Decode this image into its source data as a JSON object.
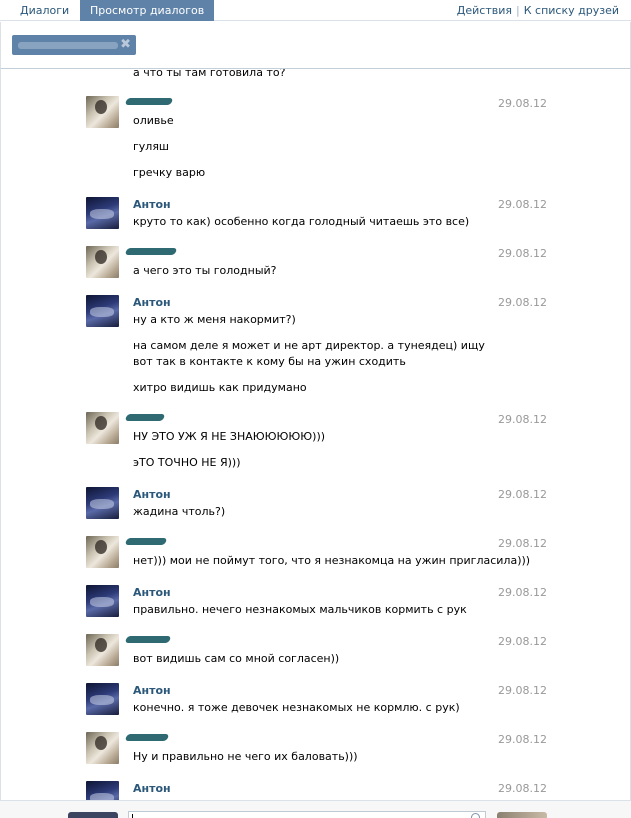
{
  "nav": {
    "tab_dialogs": "Диалоги",
    "tab_view": "Просмотр диалогов",
    "link_actions": "Действия",
    "separator": "|",
    "link_friends": "К списку друзей"
  },
  "token": {
    "close_glyph": "✖"
  },
  "messages": [
    {
      "author": "",
      "date": "",
      "lines": [
        "а что ты там готовила то?"
      ]
    },
    {
      "author": "",
      "date": "29.08.12",
      "lines": [
        "оливье",
        "гуляш",
        "гречку варю"
      ]
    },
    {
      "author": "Антон",
      "date": "29.08.12",
      "lines": [
        "круто то как) особенно когда голодный читаешь это все)"
      ]
    },
    {
      "author": "",
      "date": "29.08.12",
      "lines": [
        "а чего это ты голодный?"
      ]
    },
    {
      "author": "Антон",
      "date": "29.08.12",
      "lines": [
        "ну а кто ж меня накормит?)",
        "на самом деле я может и не арт директор. а тунеядец) ищу вот так в контакте к кому бы на ужин сходить",
        "хитро видишь как придумано"
      ]
    },
    {
      "author": "",
      "date": "29.08.12",
      "lines": [
        "НУ ЭТО УЖ Я НЕ ЗНАЮЮЮЮЮ)))",
        "эТО ТОЧНО НЕ Я)))"
      ]
    },
    {
      "author": "Антон",
      "date": "29.08.12",
      "lines": [
        "жадина чтоль?)"
      ]
    },
    {
      "author": "",
      "date": "29.08.12",
      "lines": [
        "нет))) мои не поймут того, что я незнакомца на ужин пригласила)))"
      ]
    },
    {
      "author": "Антон",
      "date": "29.08.12",
      "lines": [
        "правильно. нечего незнакомых мальчиков кормить с рук"
      ]
    },
    {
      "author": "",
      "date": "29.08.12",
      "lines": [
        "вот видишь сам со мной согласен))"
      ]
    },
    {
      "author": "Антон",
      "date": "29.08.12",
      "lines": [
        "конечно. я тоже девочек незнакомых не кормлю. с рук)"
      ]
    },
    {
      "author": "",
      "date": "29.08.12",
      "lines": [
        "Ну и правильно не чего их баловать)))"
      ]
    },
    {
      "author": "Антон",
      "date": "29.08.12",
      "lines": []
    }
  ]
}
